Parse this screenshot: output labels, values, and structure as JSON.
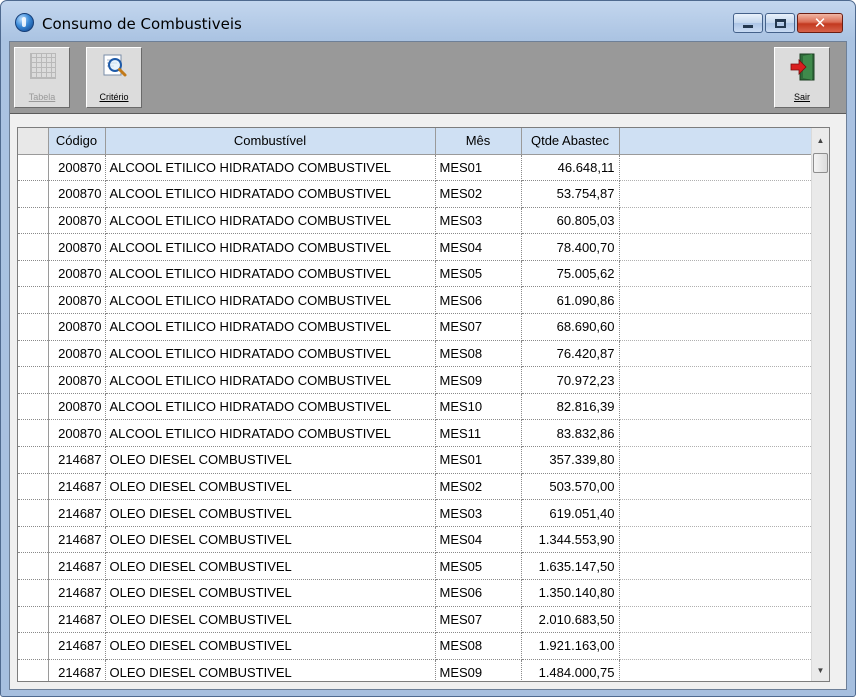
{
  "window": {
    "title": "Consumo de Combustiveis"
  },
  "window_controls": {
    "minimize": "minimize",
    "maximize": "maximize",
    "close": "✕"
  },
  "toolbar": {
    "tabela_label": "Tabela",
    "criterio_label": "Critério",
    "sair_label": "Sair"
  },
  "grid": {
    "headers": {
      "codigo": "Código",
      "combustivel": "Combustível",
      "mes": "Mês",
      "qtde": "Qtde Abastec"
    },
    "rows": [
      {
        "codigo": "200870",
        "combustivel": "ALCOOL ETILICO HIDRATADO COMBUSTIVEL",
        "mes": "MES01",
        "qtde": "46.648,11"
      },
      {
        "codigo": "200870",
        "combustivel": "ALCOOL ETILICO HIDRATADO COMBUSTIVEL",
        "mes": "MES02",
        "qtde": "53.754,87"
      },
      {
        "codigo": "200870",
        "combustivel": "ALCOOL ETILICO HIDRATADO COMBUSTIVEL",
        "mes": "MES03",
        "qtde": "60.805,03"
      },
      {
        "codigo": "200870",
        "combustivel": "ALCOOL ETILICO HIDRATADO COMBUSTIVEL",
        "mes": "MES04",
        "qtde": "78.400,70"
      },
      {
        "codigo": "200870",
        "combustivel": "ALCOOL ETILICO HIDRATADO COMBUSTIVEL",
        "mes": "MES05",
        "qtde": "75.005,62"
      },
      {
        "codigo": "200870",
        "combustivel": "ALCOOL ETILICO HIDRATADO COMBUSTIVEL",
        "mes": "MES06",
        "qtde": "61.090,86"
      },
      {
        "codigo": "200870",
        "combustivel": "ALCOOL ETILICO HIDRATADO COMBUSTIVEL",
        "mes": "MES07",
        "qtde": "68.690,60"
      },
      {
        "codigo": "200870",
        "combustivel": "ALCOOL ETILICO HIDRATADO COMBUSTIVEL",
        "mes": "MES08",
        "qtde": "76.420,87"
      },
      {
        "codigo": "200870",
        "combustivel": "ALCOOL ETILICO HIDRATADO COMBUSTIVEL",
        "mes": "MES09",
        "qtde": "70.972,23"
      },
      {
        "codigo": "200870",
        "combustivel": "ALCOOL ETILICO HIDRATADO COMBUSTIVEL",
        "mes": "MES10",
        "qtde": "82.816,39"
      },
      {
        "codigo": "200870",
        "combustivel": "ALCOOL ETILICO HIDRATADO COMBUSTIVEL",
        "mes": "MES11",
        "qtde": "83.832,86"
      },
      {
        "codigo": "214687",
        "combustivel": "OLEO DIESEL COMBUSTIVEL",
        "mes": "MES01",
        "qtde": "357.339,80"
      },
      {
        "codigo": "214687",
        "combustivel": "OLEO DIESEL COMBUSTIVEL",
        "mes": "MES02",
        "qtde": "503.570,00"
      },
      {
        "codigo": "214687",
        "combustivel": "OLEO DIESEL COMBUSTIVEL",
        "mes": "MES03",
        "qtde": "619.051,40"
      },
      {
        "codigo": "214687",
        "combustivel": "OLEO DIESEL COMBUSTIVEL",
        "mes": "MES04",
        "qtde": "1.344.553,90"
      },
      {
        "codigo": "214687",
        "combustivel": "OLEO DIESEL COMBUSTIVEL",
        "mes": "MES05",
        "qtde": "1.635.147,50"
      },
      {
        "codigo": "214687",
        "combustivel": "OLEO DIESEL COMBUSTIVEL",
        "mes": "MES06",
        "qtde": "1.350.140,80"
      },
      {
        "codigo": "214687",
        "combustivel": "OLEO DIESEL COMBUSTIVEL",
        "mes": "MES07",
        "qtde": "2.010.683,50"
      },
      {
        "codigo": "214687",
        "combustivel": "OLEO DIESEL COMBUSTIVEL",
        "mes": "MES08",
        "qtde": "1.921.163,00"
      },
      {
        "codigo": "214687",
        "combustivel": "OLEO DIESEL COMBUSTIVEL",
        "mes": "MES09",
        "qtde": "1.484.000,75"
      }
    ]
  },
  "icons": {
    "app": "app-icon",
    "tabela": "grid-icon",
    "criterio": "magnifier-icon",
    "sair": "exit-door-icon"
  },
  "colors": {
    "header_bg": "#cfe0f3",
    "toolbar_bg": "#999999"
  }
}
